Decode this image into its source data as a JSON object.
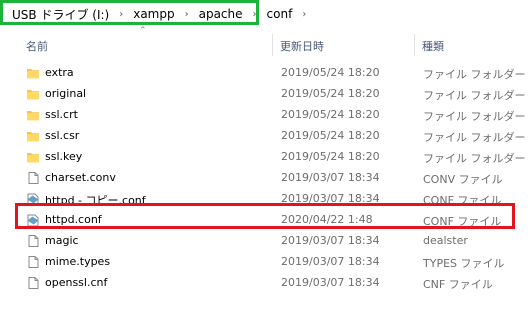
{
  "address": {
    "breadcrumbs": [
      "USB ドライブ (I:)",
      "xampp",
      "apache",
      "conf"
    ],
    "separator": "›"
  },
  "header": {
    "name": "名前",
    "date": "更新日時",
    "type": "種類"
  },
  "files": [
    {
      "name": "extra",
      "date": "2019/05/24 18:20",
      "type": "ファイル フォルダー",
      "icon": "folder-icon"
    },
    {
      "name": "original",
      "date": "2019/05/24 18:20",
      "type": "ファイル フォルダー",
      "icon": "folder-icon"
    },
    {
      "name": "ssl.crt",
      "date": "2019/05/24 18:20",
      "type": "ファイル フォルダー",
      "icon": "folder-icon"
    },
    {
      "name": "ssl.csr",
      "date": "2019/05/24 18:20",
      "type": "ファイル フォルダー",
      "icon": "folder-icon"
    },
    {
      "name": "ssl.key",
      "date": "2019/05/24 18:20",
      "type": "ファイル フォルダー",
      "icon": "folder-icon"
    },
    {
      "name": "charset.conv",
      "date": "2019/03/07 18:34",
      "type": "CONV ファイル",
      "icon": "file-icon"
    },
    {
      "name": "httpd - コピー.conf",
      "date": "2019/03/07 18:34",
      "type": "CONF ファイル",
      "icon": "config-file-icon"
    },
    {
      "name": "httpd.conf",
      "date": "2020/04/22 1:48",
      "type": "CONF ファイル",
      "icon": "config-file-icon"
    },
    {
      "name": "magic",
      "date": "2019/03/07 18:34",
      "type": "dealster",
      "icon": "file-icon"
    },
    {
      "name": "mime.types",
      "date": "2019/03/07 18:34",
      "type": "TYPES ファイル",
      "icon": "file-icon"
    },
    {
      "name": "openssl.cnf",
      "date": "2019/03/07 18:34",
      "type": "CNF ファイル",
      "icon": "file-icon"
    }
  ],
  "colors": {
    "highlight_green": "#1bb33a",
    "highlight_red": "#e2151f",
    "folder": "#f3c44b",
    "header_text": "#4a5a78"
  }
}
